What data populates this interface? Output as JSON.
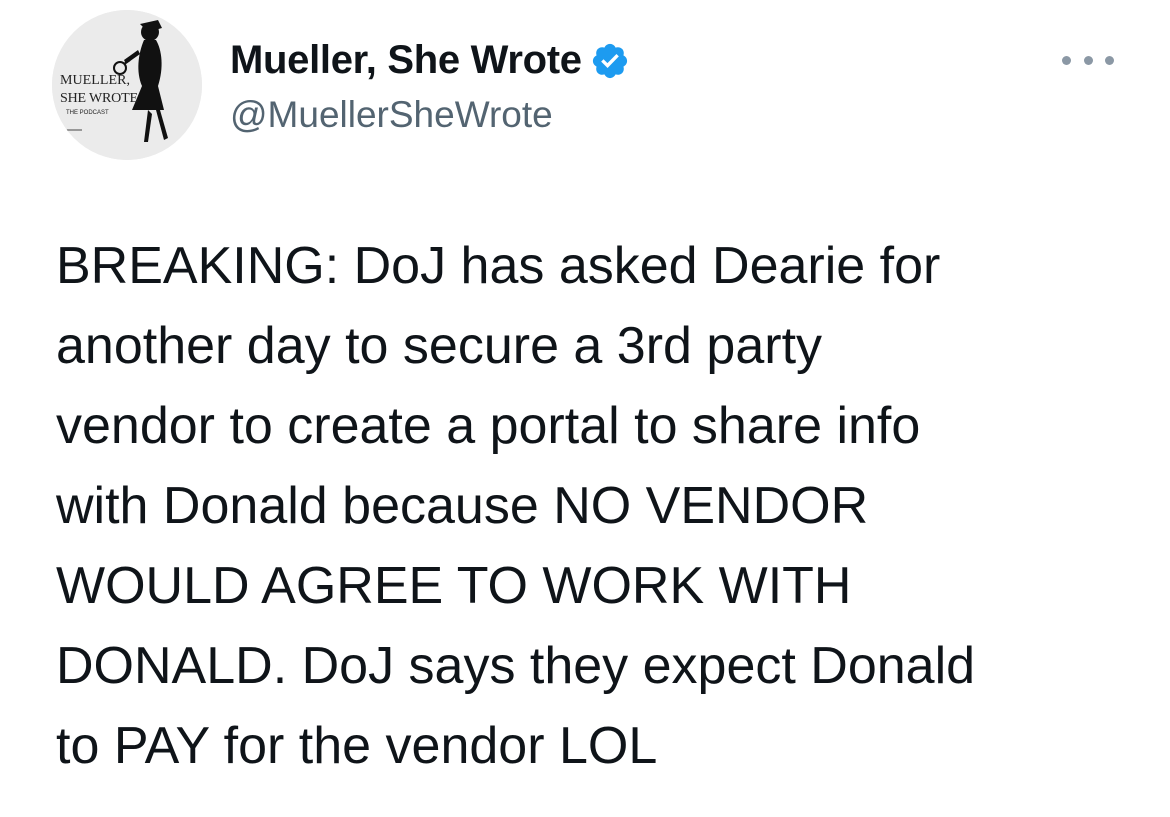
{
  "author": {
    "display_name": "Mueller, She Wrote",
    "handle": "@MuellerSheWrote",
    "verified": true,
    "avatar": {
      "icon": "silhouette-with-magnifying-glass-logo",
      "logo_text_line1": "MUELLER,",
      "logo_text_line2": "SHE WROTE",
      "logo_subtext": "THE PODCAST"
    }
  },
  "menu": {
    "icon": "more-options-icon"
  },
  "tweet": {
    "lines": [
      "BREAKING: DoJ has asked Dearie for",
      "another day to secure a 3rd party",
      "vendor to create a portal to share info",
      "with Donald because NO VENDOR",
      "WOULD AGREE TO WORK WITH",
      "DONALD. DoJ says they expect Donald",
      "to PAY for the vendor LOL"
    ]
  },
  "colors": {
    "text": "#0f1419",
    "secondary_text": "#536471",
    "verified_blue": "#1d9bf0",
    "background": "#ffffff"
  }
}
